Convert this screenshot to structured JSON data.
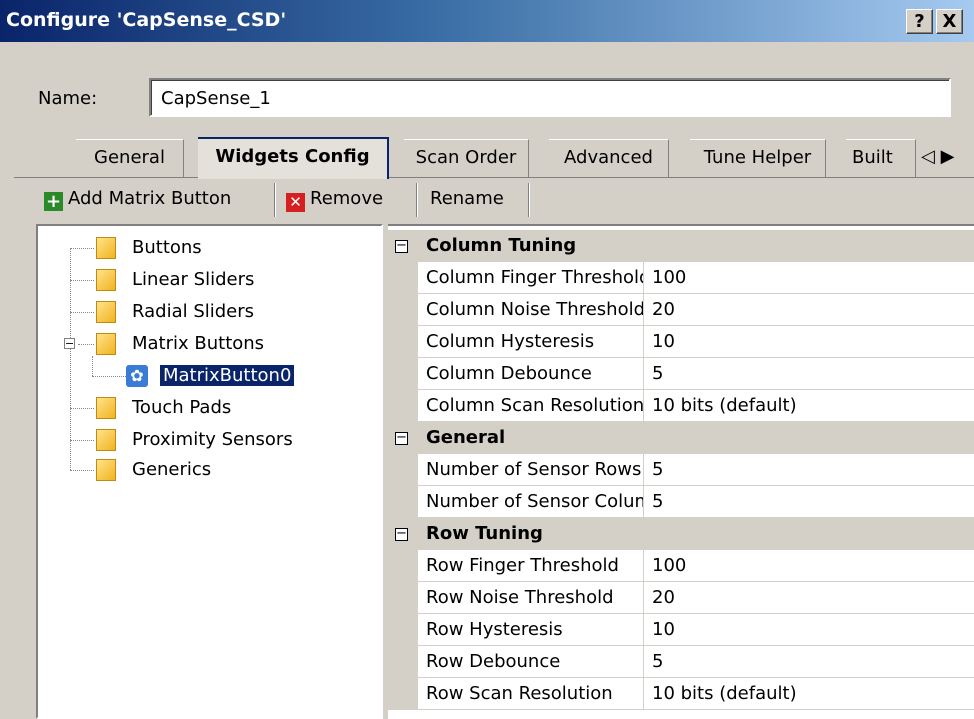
{
  "window": {
    "title": "Configure 'CapSense_CSD'",
    "help_label": "?",
    "close_label": "X"
  },
  "name_field": {
    "label": "Name:",
    "value": "CapSense_1"
  },
  "tabs": [
    {
      "label": "General"
    },
    {
      "label": "Widgets Config"
    },
    {
      "label": "Scan Order"
    },
    {
      "label": "Advanced"
    },
    {
      "label": "Tune Helper"
    },
    {
      "label": "Built"
    }
  ],
  "tab_scroll": {
    "left": "◁",
    "right": "▶"
  },
  "toolbar": {
    "add_label": "Add Matrix Button",
    "remove_label": "Remove",
    "rename_label": "Rename"
  },
  "tree": {
    "items": [
      {
        "label": "Buttons"
      },
      {
        "label": "Linear Sliders"
      },
      {
        "label": "Radial Sliders"
      },
      {
        "label": "Matrix Buttons"
      },
      {
        "label": "MatrixButton0"
      },
      {
        "label": "Touch Pads"
      },
      {
        "label": "Proximity Sensors"
      },
      {
        "label": "Generics"
      }
    ]
  },
  "properties": {
    "column_tuning": {
      "title": "Column Tuning",
      "rows": [
        {
          "name": "Column Finger Threshold",
          "value": "100"
        },
        {
          "name": "Column Noise Threshold",
          "value": "20"
        },
        {
          "name": "Column Hysteresis",
          "value": "10"
        },
        {
          "name": "Column Debounce",
          "value": "5"
        },
        {
          "name": "Column Scan Resolution",
          "value": "10 bits (default)"
        }
      ]
    },
    "general": {
      "title": "General",
      "rows": [
        {
          "name": "Number of Sensor Rows",
          "value": "5"
        },
        {
          "name": "Number of Sensor Columns",
          "value": "5"
        }
      ]
    },
    "row_tuning": {
      "title": "Row Tuning",
      "rows": [
        {
          "name": "Row Finger Threshold",
          "value": "100"
        },
        {
          "name": "Row Noise Threshold",
          "value": "20"
        },
        {
          "name": "Row Hysteresis",
          "value": "10"
        },
        {
          "name": "Row Debounce",
          "value": "5"
        },
        {
          "name": "Row Scan Resolution",
          "value": "10 bits (default)"
        }
      ]
    }
  }
}
